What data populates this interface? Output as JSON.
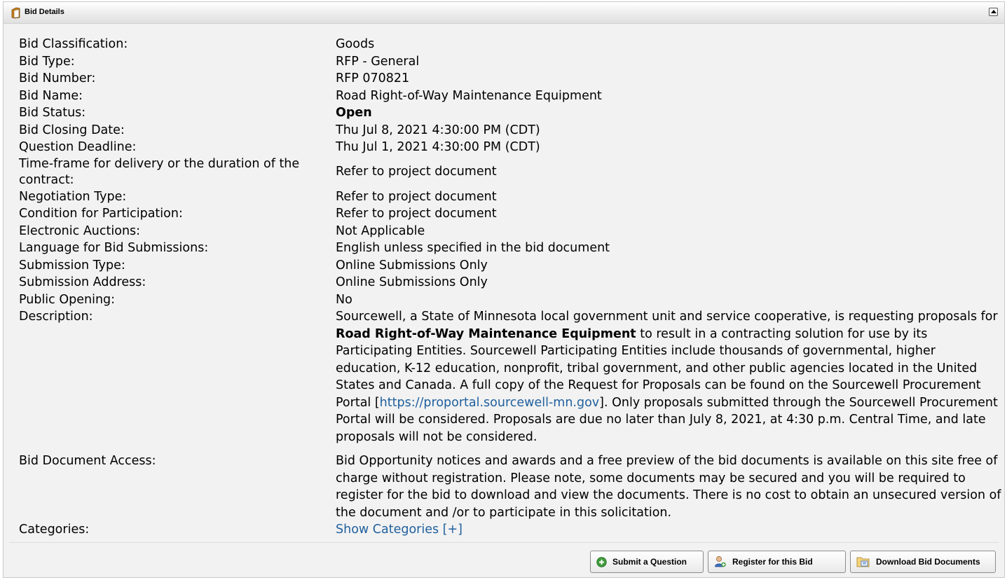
{
  "panel": {
    "title": "Bid Details",
    "header_icon": "briefcase-icon",
    "collapse_icon": "collapse-up-icon"
  },
  "fields": [
    {
      "label": "Bid Classification:",
      "value": "Goods"
    },
    {
      "label": "Bid Type:",
      "value": "RFP - General"
    },
    {
      "label": "Bid Number:",
      "value": "RFP 070821"
    },
    {
      "label": "Bid Name:",
      "value": "Road Right-of-Way Maintenance Equipment"
    },
    {
      "label": "Bid Status:",
      "value": "Open"
    },
    {
      "label": "Bid Closing Date:",
      "value": "Thu Jul 8, 2021 4:30:00 PM (CDT)"
    },
    {
      "label": "Question Deadline:",
      "value": "Thu Jul 1, 2021 4:30:00 PM (CDT)"
    },
    {
      "label": "Time-frame for delivery or the duration of the contract:",
      "value": "Refer to project document"
    },
    {
      "label": "Negotiation Type:",
      "value": "Refer to project document"
    },
    {
      "label": "Condition for Participation:",
      "value": "Refer to project document"
    },
    {
      "label": "Electronic Auctions:",
      "value": "Not Applicable"
    },
    {
      "label": "Language for Bid Submissions:",
      "value": "English unless specified in the bid document"
    },
    {
      "label": "Submission Type:",
      "value": "Online Submissions Only"
    },
    {
      "label": "Submission Address:",
      "value": "Online Submissions Only"
    },
    {
      "label": "Public Opening:",
      "value": "No"
    }
  ],
  "description": {
    "label": "Description:",
    "text_1": "Sourcewell, a State of Minnesota local government unit and service cooperative, is requesting proposals for ",
    "bold": "Road Right-of-Way Maintenance Equipment",
    "text_2": " to result in a contracting solution for use by its Participating Entities.  Sourcewell Participating Entities include thousands of governmental, higher education, K-12 education, nonprofit, tribal government, and other public agencies located in the United States and Canada. A full copy of the Request for Proposals can be found on the Sourcewell Procurement Portal [",
    "link": "https://proportal.sourcewell-mn.gov",
    "text_3": "]. Only proposals submitted through the Sourcewell Procurement Portal will be considered. Proposals are due no later than July 8, 2021, at 4:30 p.m. Central Time, and late proposals will not be considered."
  },
  "document_access": {
    "label": "Bid Document Access:",
    "value": "Bid Opportunity notices and awards and a free preview of the bid documents is available on this site free of charge without registration. Please note, some documents may be secured and you will be required to register for the bid to download and view the documents. There is no cost to obtain an unsecured version of the document and /or to participate in this solicitation."
  },
  "categories": {
    "label": "Categories:",
    "link": "Show Categories [+]"
  },
  "buttons": {
    "submit_question": "Submit a Question",
    "register": "Register for this Bid",
    "download": "Download Bid Documents"
  },
  "colors": {
    "link": "#1f5f9e",
    "panel_background": "#f2f2f2"
  }
}
